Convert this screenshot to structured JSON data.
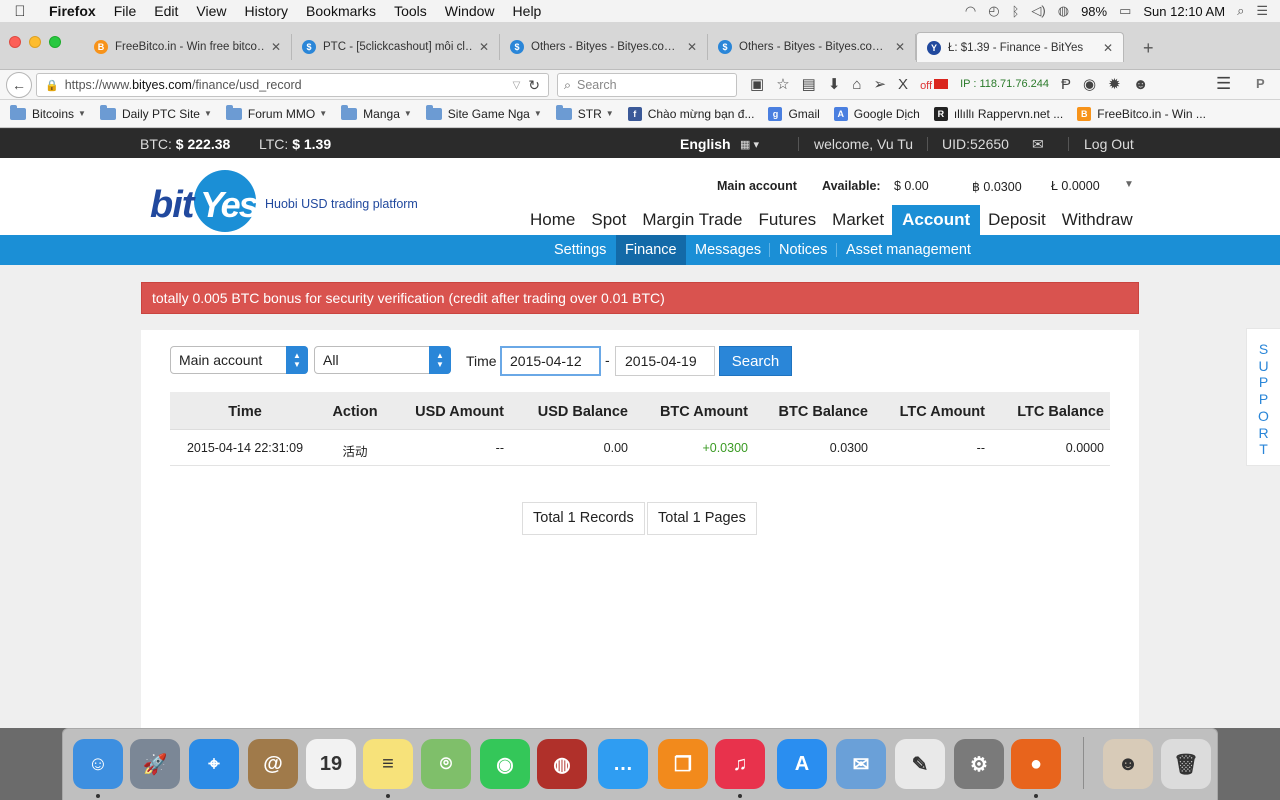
{
  "menubar": {
    "app": "Firefox",
    "items": [
      "File",
      "Edit",
      "View",
      "History",
      "Bookmarks",
      "Tools",
      "Window",
      "Help"
    ],
    "battery": "98%",
    "clock": "Sun 12:10 AM"
  },
  "tabs": [
    {
      "title": "FreeBitco.in - Win free bitco…",
      "icon": "bitcoin-icon",
      "color": "#f7931a"
    },
    {
      "title": "PTC - [5clickcashout] mỗi cl…",
      "icon": "dollar-icon",
      "color": "#2a86d8"
    },
    {
      "title": "Others - Bityes - Bityes.co…",
      "icon": "dollar-icon",
      "color": "#2a86d8"
    },
    {
      "title": "Others - Bityes - Bityes.co…",
      "icon": "dollar-icon",
      "color": "#2a86d8"
    },
    {
      "title": "Ł: $1.39 - Finance - BitYes",
      "icon": "bityes-icon",
      "color": "#21499e"
    }
  ],
  "navbar": {
    "url_prefix": "https://www.",
    "url_domain": "bityes.com",
    "url_path": "/finance/usd_record",
    "search_placeholder": "Search",
    "off_label": "off",
    "ip_label": "IP : 118.71.76.244"
  },
  "bookmarks": [
    {
      "label": "Bitcoins",
      "type": "folder"
    },
    {
      "label": "Daily PTC Site",
      "type": "folder"
    },
    {
      "label": "Forum MMO",
      "type": "folder"
    },
    {
      "label": "Manga",
      "type": "folder"
    },
    {
      "label": "Site Game Nga",
      "type": "folder"
    },
    {
      "label": "STR",
      "type": "folder"
    },
    {
      "label": "Chào mừng bạn đ...",
      "type": "link",
      "icon": "facebook-icon",
      "color": "#3b5998",
      "glyph": "f"
    },
    {
      "label": "Gmail",
      "type": "link",
      "icon": "google-icon",
      "color": "#4a7fe0",
      "glyph": "g"
    },
    {
      "label": "Google Dịch",
      "type": "link",
      "icon": "translate-icon",
      "color": "#4a7fe0",
      "glyph": "A"
    },
    {
      "label": "ıllıllı Rappervn.net ...",
      "type": "link",
      "icon": "rappervn-icon",
      "color": "#222",
      "glyph": "R"
    },
    {
      "label": "FreeBitco.in - Win ...",
      "type": "link",
      "icon": "bitcoin-icon",
      "color": "#f7931a",
      "glyph": "B"
    }
  ],
  "sitebar": {
    "btc_label": "BTC:",
    "btc_value": "$ 222.38",
    "ltc_label": "LTC:",
    "ltc_value": "$ 1.39",
    "language": "English",
    "welcome": "welcome, Vu Tu",
    "uid": "UID:52650",
    "logout": "Log Out"
  },
  "header": {
    "logo_bit": "bit",
    "logo_yes": "Yes",
    "tagline": "Huobi USD trading platform",
    "account_label": "Main account",
    "available_label": "Available:",
    "usd": "$ 0.00",
    "btc": "฿ 0.0300",
    "ltc": "Ł 0.0000"
  },
  "mainnav": [
    "Home",
    "Spot",
    "Margin Trade",
    "Futures",
    "Market",
    "Account",
    "Deposit",
    "Withdraw"
  ],
  "mainnav_active": "Account",
  "subnav": [
    "Settings",
    "Finance",
    "Messages",
    "Notices",
    "Asset management"
  ],
  "subnav_active": "Finance",
  "alert": "totally 0.005 BTC bonus for security verification (credit after trading over 0.01 BTC)",
  "filters": {
    "account": "Main account",
    "action": "All",
    "time_label": "Time",
    "date_from": "2015-04-12",
    "separator": "-",
    "date_to": "2015-04-19",
    "search_button": "Search"
  },
  "table": {
    "headers": [
      "Time",
      "Action",
      "USD Amount",
      "USD Balance",
      "BTC Amount",
      "BTC Balance",
      "LTC Amount",
      "LTC Balance"
    ],
    "rows": [
      [
        "2015-04-14 22:31:09",
        "活动",
        "--",
        "0.00",
        "+0.0300",
        "0.0300",
        "--",
        "0.0000"
      ]
    ]
  },
  "pager": {
    "records": "Total 1 Records",
    "pages": "Total 1 Pages"
  },
  "support": [
    "S",
    "U",
    "P",
    "P",
    "O",
    "R",
    "T"
  ],
  "dock": [
    {
      "name": "finder-icon",
      "glyph": "☺",
      "color": "#3d8fe0",
      "running": true
    },
    {
      "name": "launchpad-icon",
      "glyph": "🚀",
      "color": "#7b8796",
      "running": false
    },
    {
      "name": "safari-icon",
      "glyph": "⌖",
      "color": "#2b8be6",
      "running": false
    },
    {
      "name": "contacts-icon",
      "glyph": "@",
      "color": "#a07a4a",
      "running": false
    },
    {
      "name": "calendar-icon",
      "glyph": "19",
      "color": "#f2f2f2",
      "running": false
    },
    {
      "name": "notes-icon",
      "glyph": "≡",
      "color": "#f7e27a",
      "running": true
    },
    {
      "name": "maps-icon",
      "glyph": "⌾",
      "color": "#7fbf6a",
      "running": false
    },
    {
      "name": "facetime-icon",
      "glyph": "◉",
      "color": "#34c759",
      "running": false
    },
    {
      "name": "photo-booth-icon",
      "glyph": "◍",
      "color": "#b0302a",
      "running": false
    },
    {
      "name": "messages-icon",
      "glyph": "…",
      "color": "#2f9df2",
      "running": false
    },
    {
      "name": "ibooks-icon",
      "glyph": "❐",
      "color": "#f28a1c",
      "running": false
    },
    {
      "name": "itunes-icon",
      "glyph": "♫",
      "color": "#e8324c",
      "running": true
    },
    {
      "name": "app-store-icon",
      "glyph": "A",
      "color": "#2a8ef0",
      "running": false
    },
    {
      "name": "mail-icon",
      "glyph": "✉",
      "color": "#6aa0d8",
      "running": false
    },
    {
      "name": "textedit-icon",
      "glyph": "✎",
      "color": "#e9e9e9",
      "running": false
    },
    {
      "name": "system-preferences-icon",
      "glyph": "⚙",
      "color": "#7a7a7a",
      "running": false
    },
    {
      "name": "firefox-icon",
      "glyph": "●",
      "color": "#e8641c",
      "running": true
    },
    {
      "name": "user-photo-icon",
      "glyph": "☻",
      "color": "#d8cbb8",
      "running": false
    },
    {
      "name": "trash-icon",
      "glyph": "🗑",
      "color": "#dcdcdc",
      "running": false
    }
  ]
}
